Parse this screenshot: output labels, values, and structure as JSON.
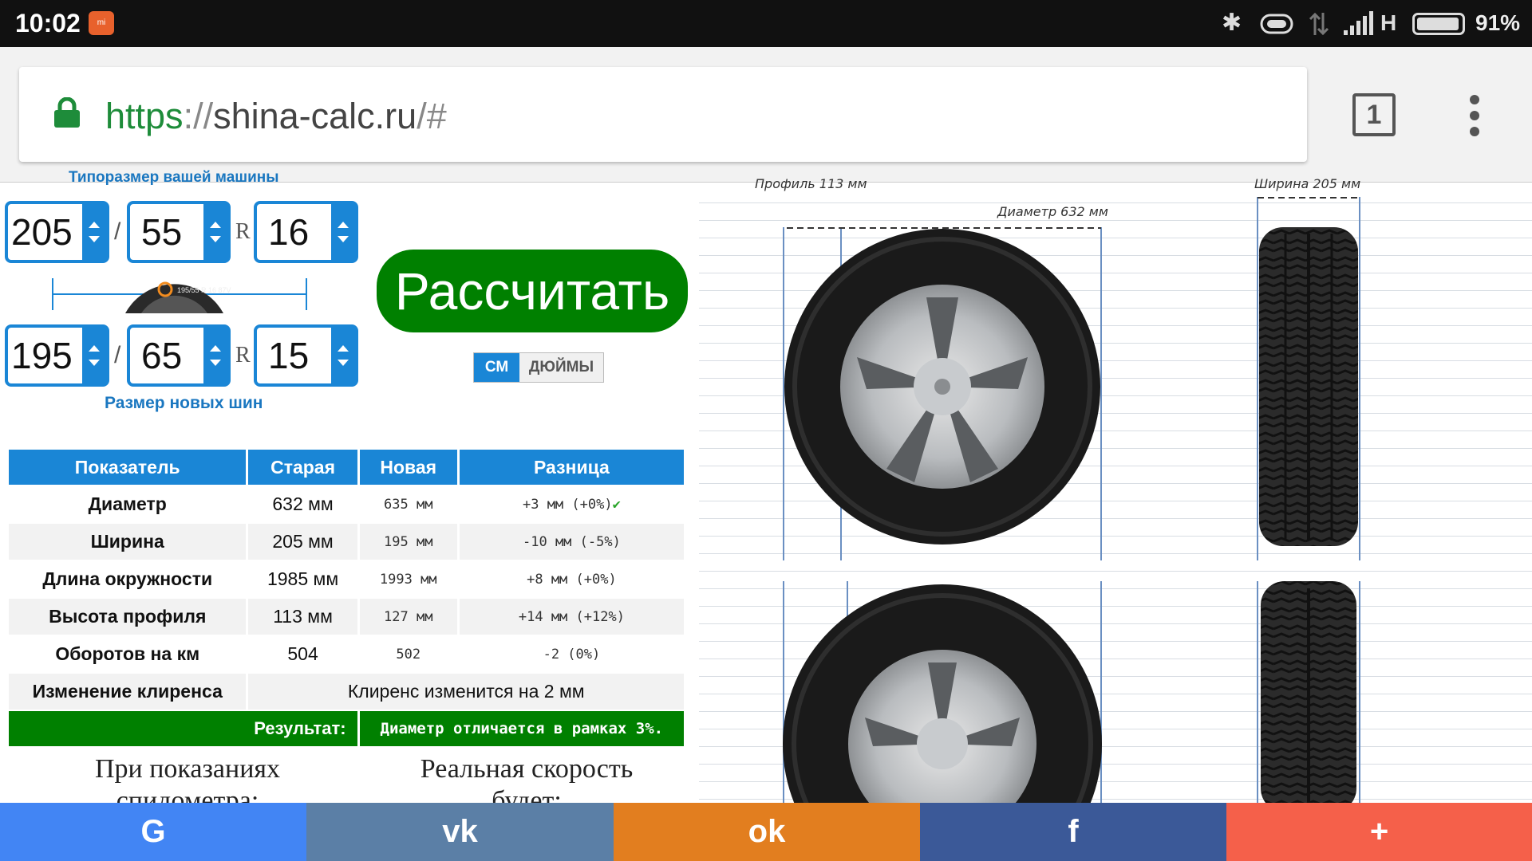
{
  "status_bar": {
    "time": "10:02",
    "network": "H",
    "battery": "91%",
    "mi_label": "mi"
  },
  "browser": {
    "url_protocol": "https",
    "url_separator": "://",
    "url_host": "shina-calc.ru",
    "url_tail": "/#",
    "tab_count": "1"
  },
  "calculator": {
    "top_label": "Типоразмер вашей машины",
    "old": {
      "width": "205",
      "profile": "55",
      "r": "R",
      "diameter": "16"
    },
    "new": {
      "width": "195",
      "profile": "65",
      "r": "R",
      "diameter": "15"
    },
    "slash": "/",
    "calculate_button": "Рассчитать",
    "unit_cm": "СМ",
    "unit_inches": "ДЮЙМЫ",
    "new_size_label": "Размер новых шин"
  },
  "table": {
    "headers": [
      "Показатель",
      "Старая",
      "Новая",
      "Разница"
    ],
    "rows": [
      {
        "label": "Диаметр",
        "old": "632 мм",
        "new": "635 мм",
        "diff": "+3 мм (+0%)"
      },
      {
        "label": "Ширина",
        "old": "205 мм",
        "new": "195 мм",
        "diff": "-10 мм (-5%)"
      },
      {
        "label": "Длина окружности",
        "old": "1985 мм",
        "new": "1993 мм",
        "diff": "+8 мм (+0%)"
      },
      {
        "label": "Высота профиля",
        "old": "113 мм",
        "new": "127 мм",
        "diff": "+14 мм (+12%)"
      },
      {
        "label": "Оборотов на км",
        "old": "504",
        "new": "502",
        "diff": "-2 (0%)"
      }
    ],
    "clearance_label": "Изменение клиренса",
    "clearance_value": "Клиренс изменится на 2 мм",
    "result_label": "Результат:",
    "result_value": "Диаметр отличается в рамках 3%.",
    "check_mark": "✔"
  },
  "speedo": {
    "left_heading": "При показаниях спидометра:",
    "right_heading": "Реальная скорость будет:"
  },
  "diagram": {
    "profile_label": "Профиль 113 мм",
    "diameter_label": "Диаметр 632 мм",
    "width_label": "Ширина 205 мм",
    "tire_marking": "195/55 R 16 87V"
  },
  "share": {
    "google": {
      "label": "G",
      "color": "#4285f4"
    },
    "vk": {
      "label": "vk",
      "color": "#5b7fa6"
    },
    "ok": {
      "label": "ok",
      "color": "#e27e1f"
    },
    "facebook": {
      "label": "f",
      "color": "#3b5998"
    },
    "more": {
      "label": "+",
      "color": "#f5604a"
    }
  }
}
